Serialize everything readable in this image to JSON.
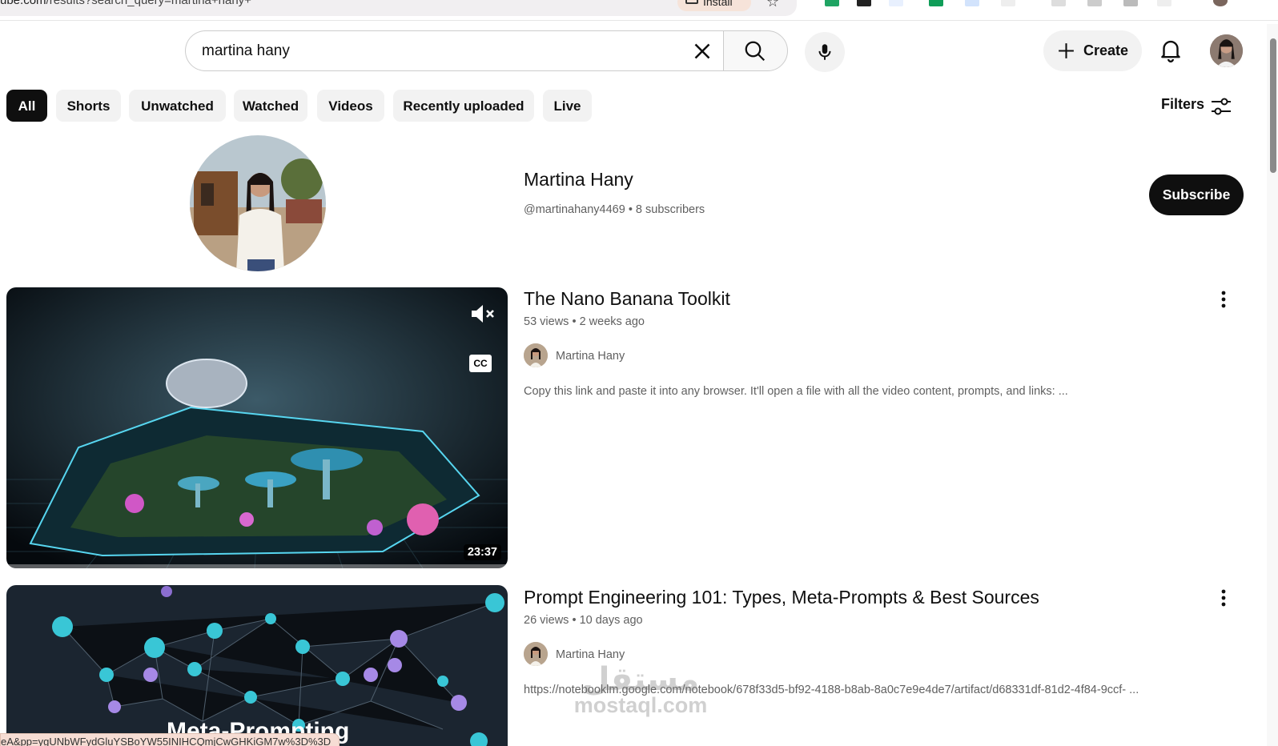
{
  "browser": {
    "url_domain": "ube.com",
    "url_path": "/results?search_query=martina+hany+",
    "install_label": "Install",
    "status_url": "eA&pp=ygUNbWFydGluYSBoYW55INIHCQmjCwGHKiGM7w%3D%3D"
  },
  "header": {
    "search_value": "martina hany",
    "search_placeholder": "Search",
    "create_label": "Create"
  },
  "chips": [
    {
      "label": "All",
      "active": true
    },
    {
      "label": "Shorts"
    },
    {
      "label": "Unwatched"
    },
    {
      "label": "Watched"
    },
    {
      "label": "Videos"
    },
    {
      "label": "Recently uploaded"
    },
    {
      "label": "Live"
    }
  ],
  "filters_label": "Filters",
  "channel": {
    "name": "Martina Hany",
    "handle": "@martinahany4469",
    "separator": "•",
    "subscribers": "8 subscribers",
    "subscribe_label": "Subscribe"
  },
  "videos": [
    {
      "title": "The Nano Banana Toolkit",
      "views": "53 views",
      "age": "2 weeks ago",
      "channel": "Martina Hany",
      "description": "Copy this link and paste it into any browser. It'll open a file with all the video content, prompts, and links: ...",
      "duration": "23:37",
      "cc_label": "CC"
    },
    {
      "title": "Prompt Engineering 101: Types, Meta-Prompts & Best Sources",
      "views": "26 views",
      "age": "10 days ago",
      "channel": "Martina Hany",
      "description": "https://notebooklm.google.com/notebook/678f33d5-bf92-4188-b8ab-8a0c7e9e4de7/artifact/d68331df-81d2-4f84-9ccf- ...",
      "thumb_text": "Meta-Prompting"
    }
  ],
  "watermark": {
    "arabic": "مستقل",
    "latin": "mostaql.com"
  }
}
